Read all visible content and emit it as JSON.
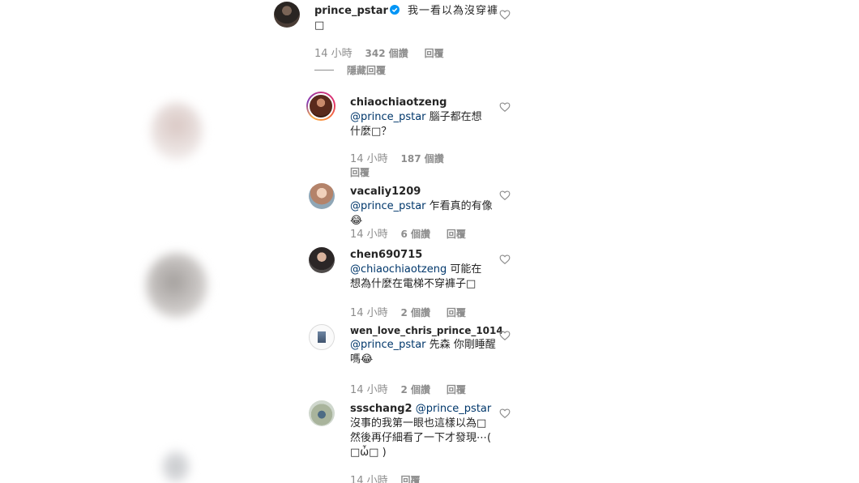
{
  "comments": [
    {
      "username": "prince_pstar",
      "verified": true,
      "text": "我一看以為沒穿褲□",
      "time": "14 小時",
      "likes": "342 個讚",
      "reply": "回覆",
      "hide_replies": "隱藏回覆"
    },
    {
      "username": "chiaochiaotzeng",
      "mention": "@prince_pstar",
      "text": " 腦子都在想什麼□？",
      "time": "14 小時",
      "likes": "187 個讚",
      "reply": "回覆"
    },
    {
      "username": "vacaliy1209",
      "mention": "@prince_pstar",
      "text": "乍看真的有像😂",
      "time": "14 小時",
      "likes": "6 個讚",
      "reply": "回覆"
    },
    {
      "username": "chen690715",
      "mention": "@chiaochiaotzeng",
      "text": " 可能在想為什麼在電梯不穿褲子□",
      "time": "14 小時",
      "likes": "2 個讚",
      "reply": "回覆"
    },
    {
      "username": "wen_love_chris_prince_1014",
      "mention": "@prince_pstar",
      "text": " 先森 你剛睡醒嗎😂",
      "time": "14 小時",
      "likes": "2 個讚",
      "reply": "回覆"
    },
    {
      "username": "ssschang2",
      "mention": "@prince_pstar",
      "text": "沒事的我第一眼也這樣以為□然後再仔細看了一下才發現⋯( □ὦ□ )",
      "time": "14 小時",
      "reply": "回覆"
    }
  ],
  "colors": {
    "text": "#262626",
    "meta": "#8e8e8e",
    "mention": "#00376b",
    "verified": "#0095f6"
  },
  "icons": {
    "like": "heart-outline-icon",
    "verified": "verified-badge-icon"
  }
}
